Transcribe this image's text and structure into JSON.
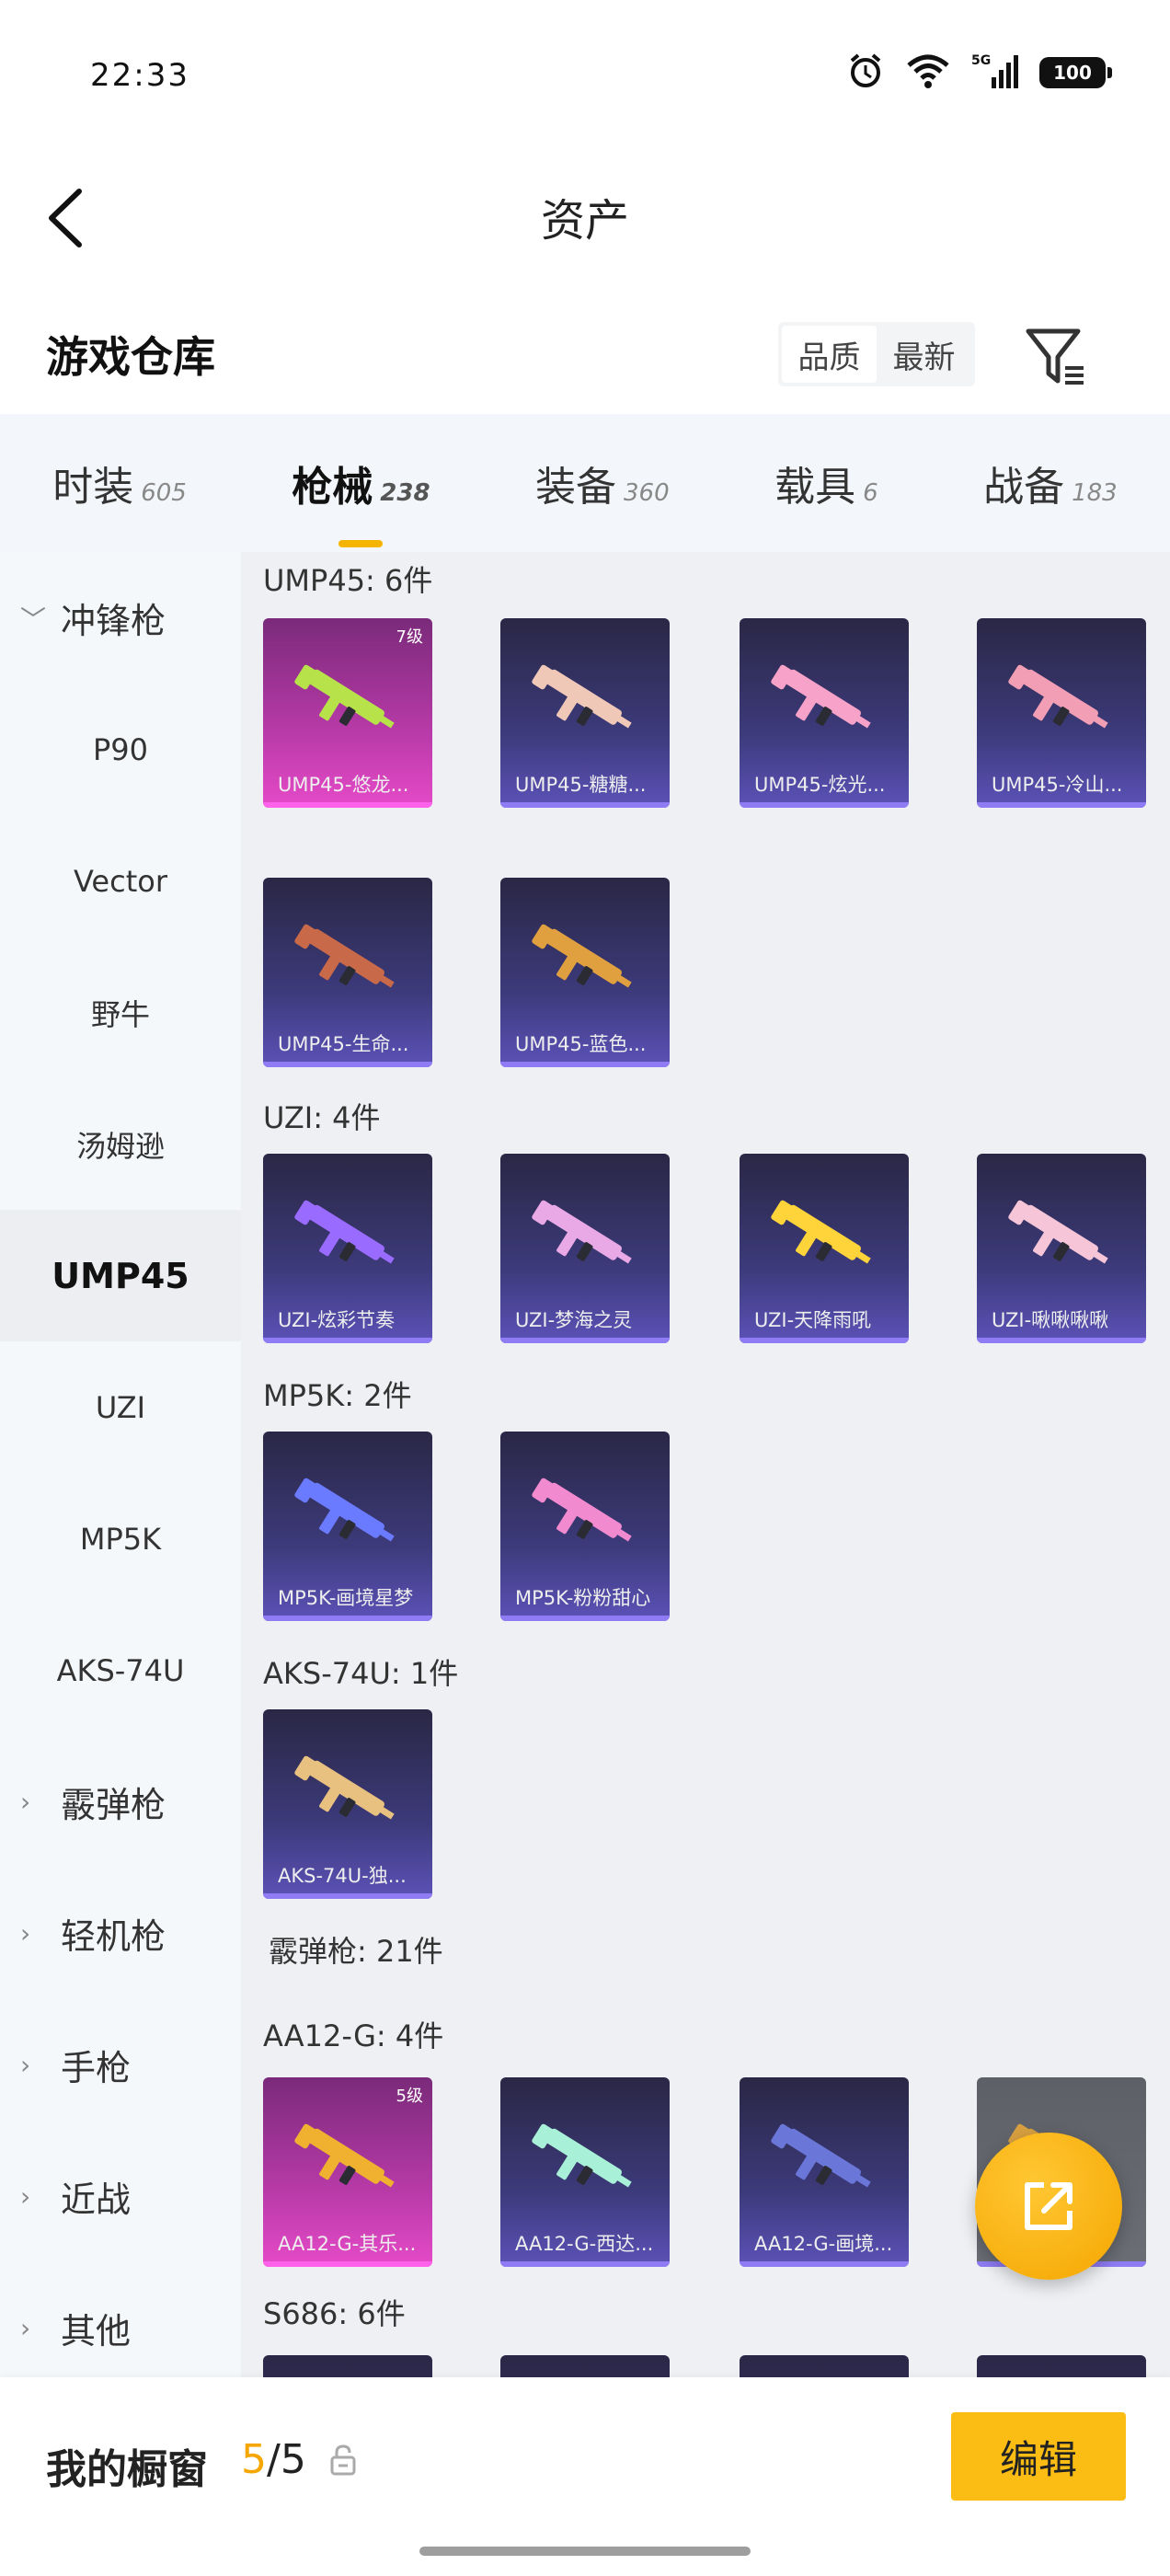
{
  "status_bar": {
    "time": "22:33",
    "battery": "100",
    "network": "5G",
    "icons": [
      "alarm-icon",
      "wifi-icon",
      "signal-icon",
      "battery-icon"
    ]
  },
  "header": {
    "title": "资产",
    "back_icon": "chevron-left-icon"
  },
  "warehouse": {
    "title": "游戏仓库",
    "sort_options": [
      "品质",
      "最新"
    ],
    "filter_icon": "filter-icon"
  },
  "tabs": [
    {
      "label": "时装",
      "count": "605"
    },
    {
      "label": "枪械",
      "count": "238"
    },
    {
      "label": "装备",
      "count": "360"
    },
    {
      "label": "载具",
      "count": "6"
    },
    {
      "label": "战备",
      "count": "183"
    }
  ],
  "sidebar": {
    "items": [
      "冲锋枪",
      "P90",
      "Vector",
      "野牛",
      "汤姆逊",
      "UMP45",
      "UZI",
      "MP5K",
      "AKS-74U",
      "霰弹枪",
      "轻机枪",
      "手枪",
      "近战",
      "其他"
    ]
  },
  "sections": [
    {
      "label": "UMP45: 6件",
      "cards": [
        {
          "name": "UMP45-悠龙...",
          "level": "7级",
          "rarity": "pink"
        },
        {
          "name": "UMP45-糖糖...",
          "rarity": "purple"
        },
        {
          "name": "UMP45-炫光...",
          "rarity": "purple"
        },
        {
          "name": "UMP45-冷山...",
          "rarity": "purple"
        },
        {
          "name": "UMP45-生命...",
          "rarity": "purple"
        },
        {
          "name": "UMP45-蓝色...",
          "rarity": "purple"
        }
      ]
    },
    {
      "label": "UZI: 4件",
      "cards": [
        {
          "name": "UZI-炫彩节奏",
          "rarity": "purple"
        },
        {
          "name": "UZI-梦海之灵",
          "rarity": "purple"
        },
        {
          "name": "UZI-天降雨吼",
          "rarity": "purple"
        },
        {
          "name": "UZI-啾啾啾啾",
          "rarity": "purple"
        }
      ]
    },
    {
      "label": "MP5K: 2件",
      "cards": [
        {
          "name": "MP5K-画境星梦",
          "rarity": "purple"
        },
        {
          "name": "MP5K-粉粉甜心",
          "rarity": "purple"
        }
      ]
    },
    {
      "label": "AKS-74U: 1件",
      "cards": [
        {
          "name": "AKS-74U-独...",
          "rarity": "purple"
        }
      ]
    },
    {
      "label": "霰弹枪: 21件",
      "cards": []
    },
    {
      "label": "AA12-G: 4件",
      "cards": [
        {
          "name": "AA12-G-其乐...",
          "level": "5级",
          "rarity": "pink"
        },
        {
          "name": "AA12-G-西达...",
          "rarity": "purple"
        },
        {
          "name": "AA12-G-画境...",
          "rarity": "purple"
        },
        {
          "name": "",
          "rarity": "gray"
        }
      ]
    },
    {
      "label": "S686: 6件",
      "cards": []
    }
  ],
  "fab": {
    "icon": "share-external-icon"
  },
  "bottom_bar": {
    "label": "我的橱窗",
    "count_current": "5",
    "count_total": "/5",
    "lock_icon": "lock-icon",
    "edit_label": "编辑"
  },
  "colors": {
    "accent": "#f5a600",
    "button": "#fbbd14"
  }
}
